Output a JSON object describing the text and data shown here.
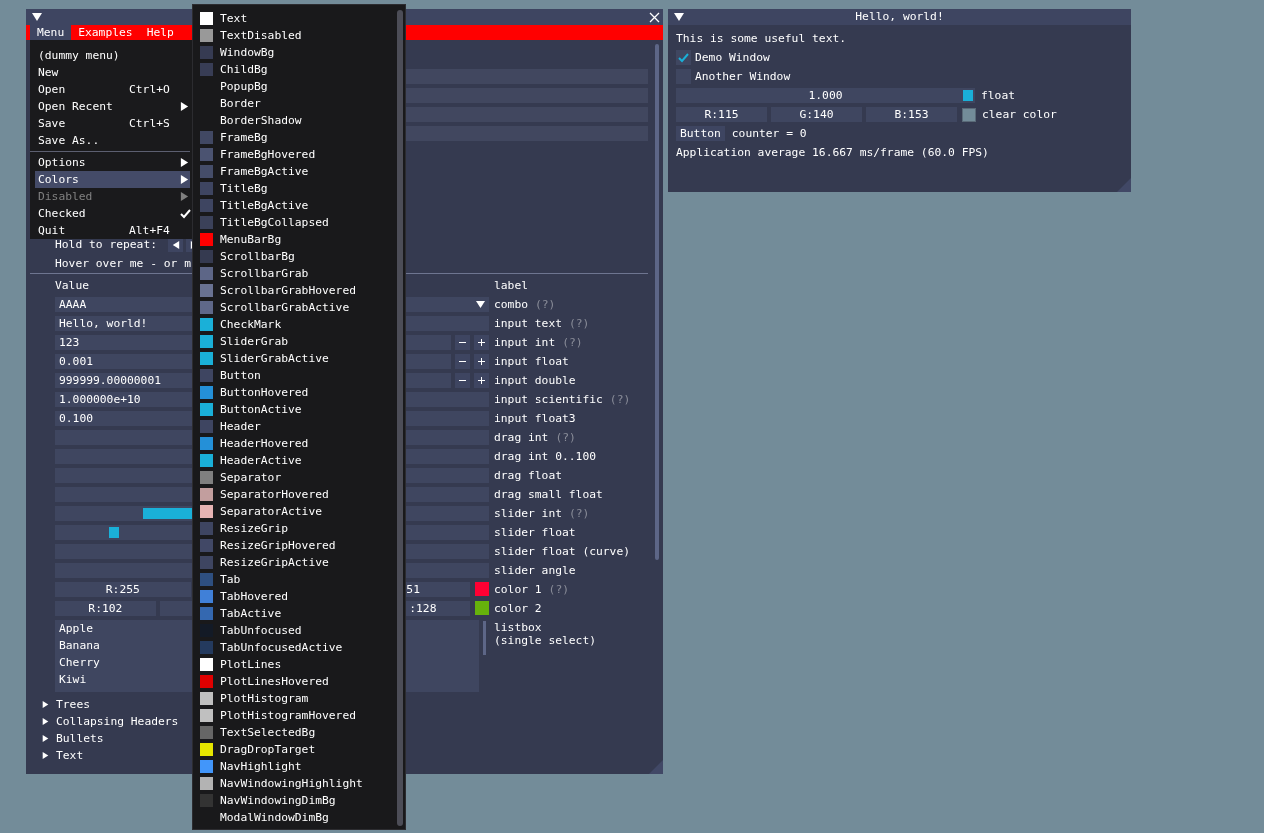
{
  "demo_window": {
    "menu_bar": [
      {
        "label": "Menu",
        "selected": true
      },
      {
        "label": "Examples",
        "selected": false
      },
      {
        "label": "Help",
        "selected": false
      }
    ],
    "repeat_label": "Hold to repeat:",
    "hover_text": "Hover over me - or m",
    "columns": [
      "Value",
      "label"
    ],
    "widgets": [
      {
        "kind": "combo",
        "value": "AAAA",
        "label": "combo",
        "help": "(?)"
      },
      {
        "kind": "input",
        "value": "Hello, world!",
        "label": "input text",
        "help": "(?)"
      },
      {
        "kind": "stepper",
        "value": "123",
        "label": "input int",
        "help": "(?)"
      },
      {
        "kind": "stepper",
        "value": "0.001",
        "label": "input float"
      },
      {
        "kind": "stepper",
        "value": "999999.00000001",
        "label": "input double"
      },
      {
        "kind": "input",
        "value": "1.000000e+10",
        "label": "input scientific",
        "help": "(?)"
      },
      {
        "kind": "triple",
        "value": "0.100",
        "label": "input float3"
      },
      {
        "kind": "input",
        "label": "drag int",
        "help": "(?)"
      },
      {
        "kind": "input",
        "label": "drag int 0..100"
      },
      {
        "kind": "input",
        "label": "drag float"
      },
      {
        "kind": "input",
        "label": "drag small float"
      },
      {
        "kind": "int_slider",
        "level": 0.25,
        "label": "slider int",
        "help": "(?)"
      },
      {
        "kind": "slider",
        "level": 0.124,
        "label": "slider float"
      },
      {
        "kind": "input",
        "label": "slider float (curve)"
      },
      {
        "kind": "input",
        "label": "slider angle"
      },
      {
        "kind": "color3",
        "first": "R:255",
        "last": "51",
        "color": "#ff0033",
        "label": "color 1",
        "help": "(?)"
      },
      {
        "kind": "color4",
        "first": "R:102",
        "last": ":128",
        "color": "#66b20c",
        "label": "color 2"
      },
      {
        "kind": "listbox",
        "items": [
          "Apple",
          "Banana",
          "Cherry",
          "Kiwi"
        ],
        "label": "listbox\n(single select)"
      }
    ],
    "tree_nodes": [
      "Trees",
      "Collapsing Headers",
      "Bullets",
      "Text"
    ]
  },
  "menu": {
    "items": [
      {
        "kind": "item",
        "label": "(dummy menu)",
        "selected": false,
        "disabled": false,
        "checked": false
      },
      {
        "kind": "item",
        "label": "New",
        "selected": false,
        "disabled": false,
        "checked": false
      },
      {
        "kind": "item",
        "label": "Open",
        "shortcut": "Ctrl+O",
        "selected": false,
        "disabled": false,
        "checked": false
      },
      {
        "kind": "submenu",
        "label": "Open Recent",
        "selected": false,
        "disabled": false,
        "checked": false
      },
      {
        "kind": "item",
        "label": "Save",
        "shortcut": "Ctrl+S",
        "selected": false,
        "disabled": false,
        "checked": false
      },
      {
        "kind": "item",
        "label": "Save As..",
        "selected": false,
        "disabled": false,
        "checked": false
      },
      {
        "kind": "separator"
      },
      {
        "kind": "submenu",
        "label": "Options",
        "selected": false,
        "disabled": false,
        "checked": false
      },
      {
        "kind": "submenu",
        "label": "Colors",
        "selected": true,
        "disabled": false,
        "checked": false
      },
      {
        "kind": "submenu",
        "label": "Disabled",
        "selected": false,
        "disabled": true,
        "checked": false
      },
      {
        "kind": "item",
        "label": "Checked",
        "selected": false,
        "disabled": false,
        "checked": true
      },
      {
        "kind": "item",
        "label": "Quit",
        "shortcut": "Alt+F4",
        "selected": false,
        "disabled": false,
        "checked": false
      }
    ]
  },
  "colors_popup": {
    "items": [
      {
        "label": "Text",
        "color": "#ffffff"
      },
      {
        "label": "TextDisabled",
        "color": "#999999"
      },
      {
        "label": "WindowBg",
        "color": "#363b52"
      },
      {
        "label": "ChildBg",
        "color": "#383d55"
      },
      {
        "label": "PopupBg"
      },
      {
        "label": "Border"
      },
      {
        "label": "BorderShadow"
      },
      {
        "label": "FrameBg",
        "color": "#414863"
      },
      {
        "label": "FrameBgHovered",
        "color": "#4b5371"
      },
      {
        "label": "FrameBgActive",
        "color": "#454d69"
      },
      {
        "label": "TitleBg",
        "color": "#3e4561"
      },
      {
        "label": "TitleBgActive",
        "color": "#3e4561"
      },
      {
        "label": "TitleBgCollapsed",
        "color": "#3b4159"
      },
      {
        "label": "MenuBarBg",
        "color": "#ff0000"
      },
      {
        "label": "ScrollbarBg",
        "color": "#353a50"
      },
      {
        "label": "ScrollbarGrab",
        "color": "#5d6687"
      },
      {
        "label": "ScrollbarGrabHovered",
        "color": "#697292"
      },
      {
        "label": "ScrollbarGrabActive",
        "color": "#5f6889"
      },
      {
        "label": "CheckMark",
        "color": "#1ab0d8"
      },
      {
        "label": "SliderGrab",
        "color": "#1ab0d8"
      },
      {
        "label": "SliderGrabActive",
        "color": "#1ab0d8"
      },
      {
        "label": "Button",
        "color": "#3e4561"
      },
      {
        "label": "ButtonHovered",
        "color": "#2490d8"
      },
      {
        "label": "ButtonActive",
        "color": "#1ab0d8"
      },
      {
        "label": "Header",
        "color": "#3e4561"
      },
      {
        "label": "HeaderHovered",
        "color": "#2490d8"
      },
      {
        "label": "HeaderActive",
        "color": "#1ab0d8"
      },
      {
        "label": "Separator",
        "color": "#808080"
      },
      {
        "label": "SeparatorHovered",
        "color": "#c29e9e"
      },
      {
        "label": "SeparatorActive",
        "color": "#e6b3b3"
      },
      {
        "label": "ResizeGrip",
        "color": "#3e4561"
      },
      {
        "label": "ResizeGripHovered",
        "color": "#414866"
      },
      {
        "label": "ResizeGripActive",
        "color": "#3e4561"
      },
      {
        "label": "Tab",
        "color": "#2e4f80"
      },
      {
        "label": "TabHovered",
        "color": "#4080d8"
      },
      {
        "label": "TabActive",
        "color": "#3468b0"
      },
      {
        "label": "TabUnfocused",
        "color": "#131a26"
      },
      {
        "label": "TabUnfocusedActive",
        "color": "#243a5e"
      },
      {
        "label": "PlotLines",
        "color": "#ffffff"
      },
      {
        "label": "PlotLinesHovered",
        "color": "#e00000"
      },
      {
        "label": "PlotHistogram",
        "color": "#c0c0c0"
      },
      {
        "label": "PlotHistogramHovered",
        "color": "#c0c0c0"
      },
      {
        "label": "TextSelectedBg",
        "color": "#666666"
      },
      {
        "label": "DragDropTarget",
        "color": "#e6e600"
      },
      {
        "label": "NavHighlight",
        "color": "#4296fa"
      },
      {
        "label": "NavWindowingHighlight",
        "color": "#b3b3b3"
      },
      {
        "label": "NavWindowingDimBg",
        "color": "#333333"
      },
      {
        "label": "ModalWindowDimBg"
      }
    ]
  },
  "hello_window": {
    "title": "Hello, world!",
    "text": "This is some useful text.",
    "checkboxes": [
      {
        "label": "Demo Window",
        "checked": true
      },
      {
        "label": "Another Window",
        "checked": false
      }
    ],
    "slider": {
      "value": "1.000",
      "level": 1,
      "label": "float"
    },
    "color_edit": {
      "channels": [
        "R:115",
        "G:140",
        "B:153"
      ],
      "color": "#738c99",
      "label": "clear color"
    },
    "button": "Button",
    "counter": "counter = 0",
    "stats": "Application average 16.667 ms/frame (60.0 FPS)"
  }
}
